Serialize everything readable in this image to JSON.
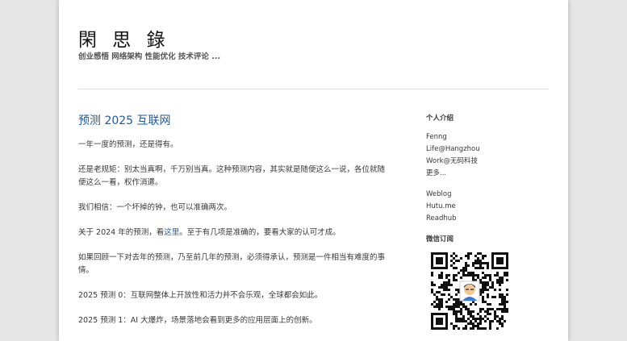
{
  "site": {
    "title": "閑 思 錄",
    "description": "创业感悟 网络架构 性能优化 技术评论 ..."
  },
  "post": {
    "title": "预测 2025 互联网",
    "p1": "一年一度的预测，还是得有。",
    "p2": "还是老规矩：别太当真啊，千万别当真。这种预测内容，其实就是随便这么一说，各位就随便这么一看，权作消遣。",
    "p3": "我们相信：一个坏掉的钟，也可以准确两次。",
    "p4_before": "关于 2024 年的预测，看",
    "p4_link": "这里",
    "p4_after": "。至于有几项是准确的，要看大家的认可才成。",
    "p5": "如果回顾一下对去年的预测，乃至前几年的预测，必须得承认，预测是一件相当有难度的事情。",
    "p6": "2025 预测 0：互联网整体上开放性和活力并不会乐观，全球都会如此。",
    "p7": "2025 预测 1：AI 大爆炸，场景落地会看到更多的应用层面上的创新。"
  },
  "sidebar": {
    "about_title": "个人介绍",
    "about_lines": [
      "Fenng",
      "Life@Hangzhou",
      "Work@无码科技",
      "更多..."
    ],
    "links": [
      "Weblog",
      "Hutu.me",
      "Readhub"
    ],
    "wechat_title": "微信订阅"
  }
}
